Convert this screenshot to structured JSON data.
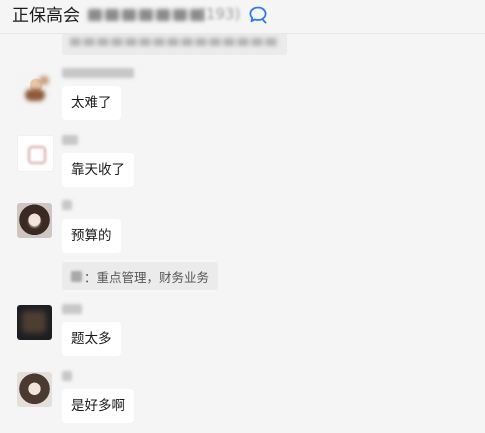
{
  "header": {
    "title": "正保高会",
    "member_count": "(193)"
  },
  "messages": [
    {
      "text": "太难了"
    },
    {
      "text": "靠天收了"
    },
    {
      "text": "预算的"
    },
    {
      "text": "题太多"
    },
    {
      "text": "是好多啊"
    }
  ],
  "notice": {
    "text": "：重点管理，财务业务"
  }
}
